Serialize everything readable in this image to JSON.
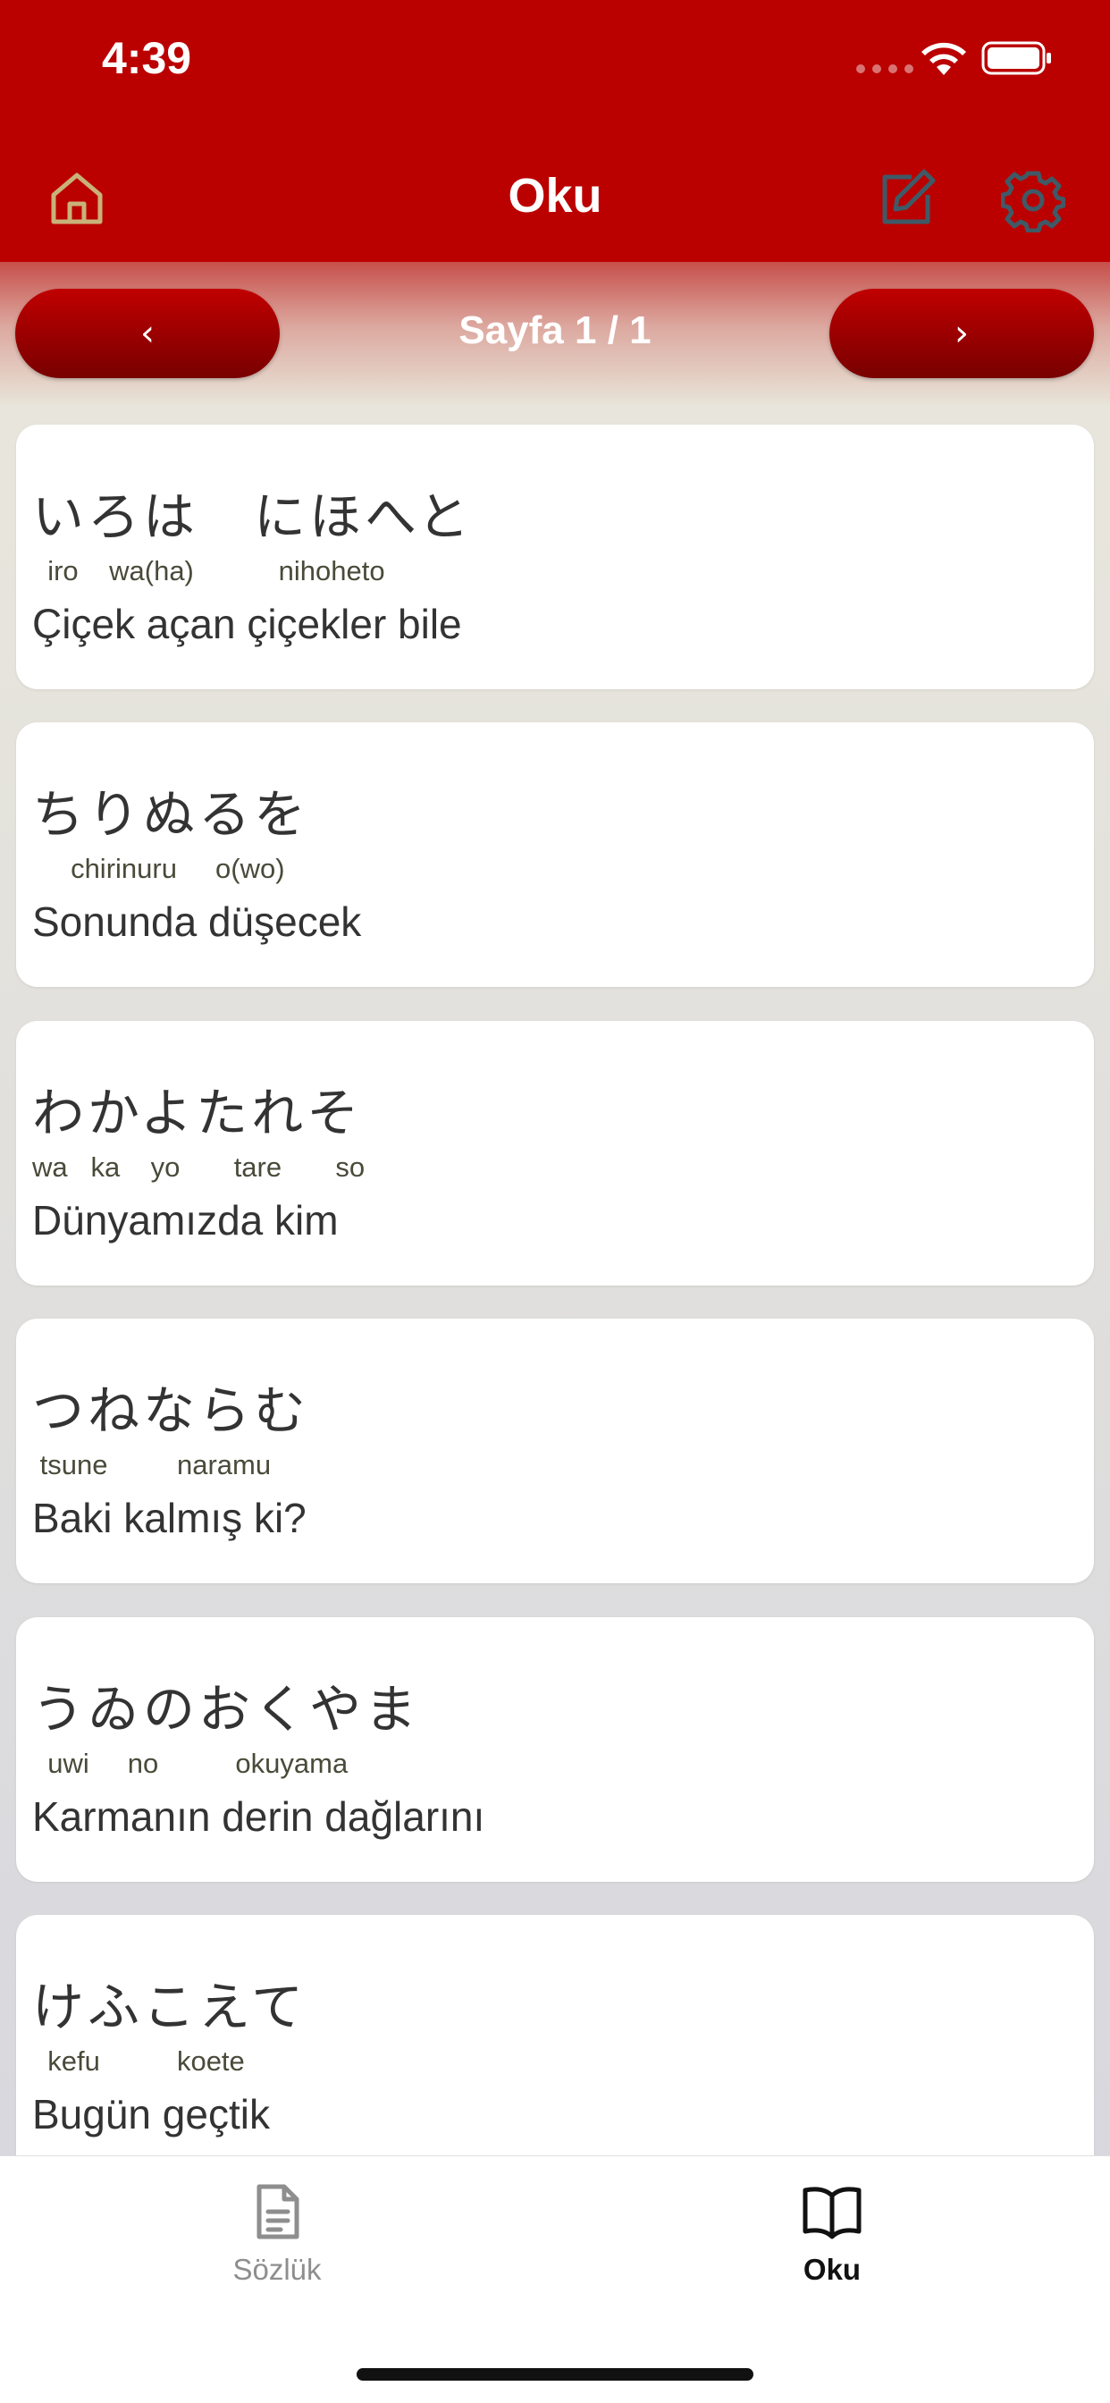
{
  "status_bar": {
    "time": "4:39"
  },
  "nav": {
    "title": "Oku"
  },
  "pager": {
    "prev_label": "‹",
    "label": "Sayfa 1 / 1",
    "next_label": "›"
  },
  "lines": [
    {
      "kana": "いろは　にほへと",
      "romaji": "  iro    wa(ha)           nihoheto",
      "meaning": "Çiçek açan çiçekler bile"
    },
    {
      "kana": "ちりぬるを",
      "romaji": "     chirinuru     o(wo)",
      "meaning": "Sonunda düşecek"
    },
    {
      "kana": "わかよたれそ",
      "romaji": "wa   ka    yo       tare       so",
      "meaning": "Dünyamızda kim"
    },
    {
      "kana": "つねならむ",
      "romaji": " tsune         naramu",
      "meaning": "Baki kalmış ki?"
    },
    {
      "kana": "うゐのおくやま",
      "romaji": "  uwi     no          okuyama",
      "meaning": "Karmanın derin dağlarını"
    },
    {
      "kana": "けふこえて",
      "romaji": "  kefu          koete",
      "meaning": "Bugün geçtik"
    }
  ],
  "tabbar": {
    "dictionary_label": "Sözlük",
    "read_label": "Oku",
    "active": "read"
  },
  "colors": {
    "header_red": "#bb0000",
    "button_red": "#a00000",
    "home_icon": "#c9b27a",
    "nav_icons": "#3f5a66"
  }
}
